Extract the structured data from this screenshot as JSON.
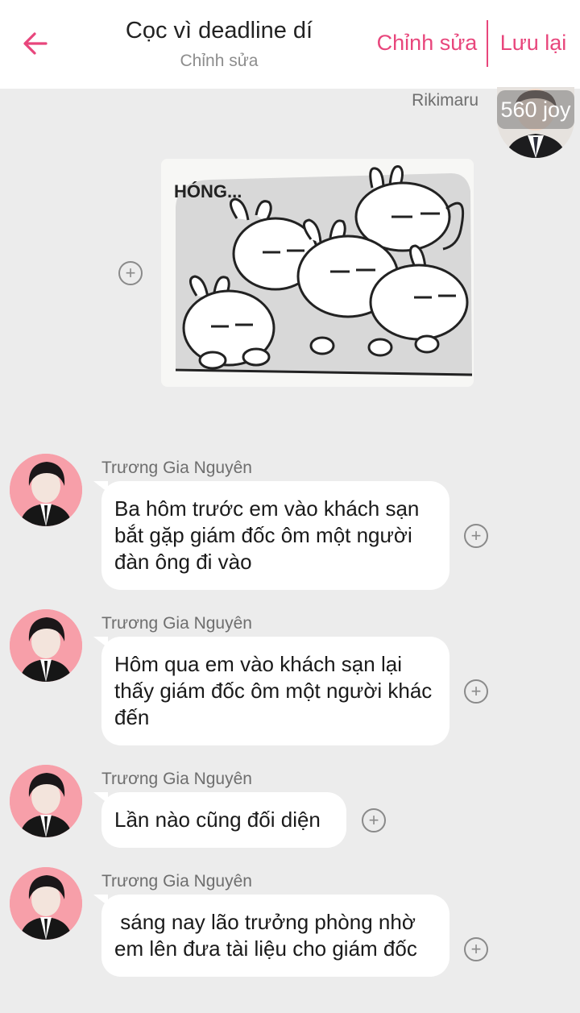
{
  "header": {
    "title": "Cọc vì deadline dí",
    "subtitle": "Chỉnh sửa",
    "edit_label": "Chỉnh sửa",
    "save_label": "Lưu lại",
    "accent_color": "#e8467c",
    "back_icon": "arrow-left-icon"
  },
  "me": {
    "name": "Rikimaru",
    "badge": "560 joy"
  },
  "sticker": {
    "caption": "HÓNG..."
  },
  "messages": [
    {
      "sender": "Trương Gia Nguyên",
      "text": "Ba hôm trước em vào khách sạn bắt gặp giám đốc ôm một người đàn ông đi vào"
    },
    {
      "sender": "Trương Gia Nguyên",
      "text": "Hôm qua em vào khách sạn lại thấy giám đốc ôm một người khác đến"
    },
    {
      "sender": "Trương Gia Nguyên",
      "text": "Lần nào cũng đối diện"
    },
    {
      "sender": "Trương Gia Nguyên",
      "text": " sáng nay lão trưởng phòng nhờ em lên đưa tài liệu cho giám đốc"
    }
  ],
  "icons": {
    "add": "plus-circle-icon"
  }
}
